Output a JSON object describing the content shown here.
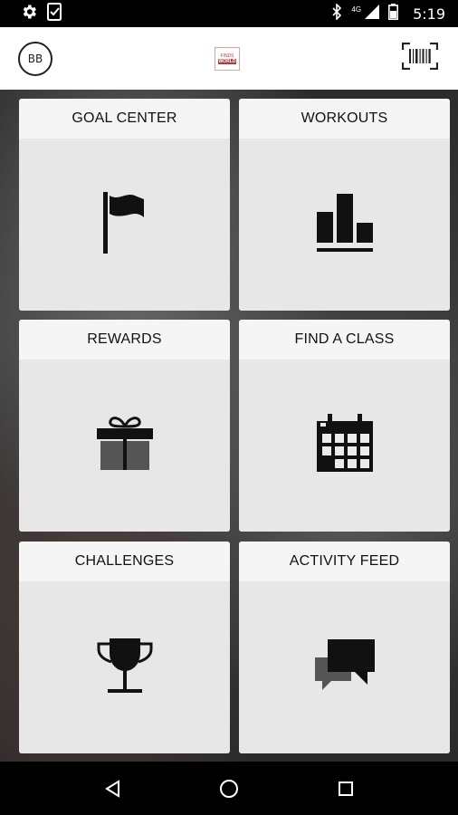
{
  "status_bar": {
    "time": "5:19",
    "network": "4G",
    "icons": [
      "settings-icon",
      "clipboard-check-icon",
      "bluetooth-icon",
      "signal-icon",
      "battery-icon"
    ]
  },
  "app_bar": {
    "avatar_initials": "BB",
    "logo_line1": "FINDS",
    "logo_line2": "WORLD",
    "icons": [
      "logo-icon",
      "barcode-scanner-icon"
    ]
  },
  "tiles": [
    {
      "label": "GOAL CENTER",
      "icon": "flag-icon"
    },
    {
      "label": "WORKOUTS",
      "icon": "bar-chart-icon"
    },
    {
      "label": "REWARDS",
      "icon": "gift-icon"
    },
    {
      "label": "FIND A CLASS",
      "icon": "calendar-icon"
    },
    {
      "label": "CHALLENGES",
      "icon": "trophy-icon"
    },
    {
      "label": "ACTIVITY FEED",
      "icon": "chat-bubbles-icon"
    }
  ],
  "nav_bar": {
    "icons": [
      "back-icon",
      "home-icon",
      "recents-icon"
    ]
  },
  "colors": {
    "tile_background": "#ebebeb",
    "tile_header": "#f5f5f5",
    "icon": "#111111",
    "app_bar": "#ffffff",
    "system_bars": "#000000"
  }
}
